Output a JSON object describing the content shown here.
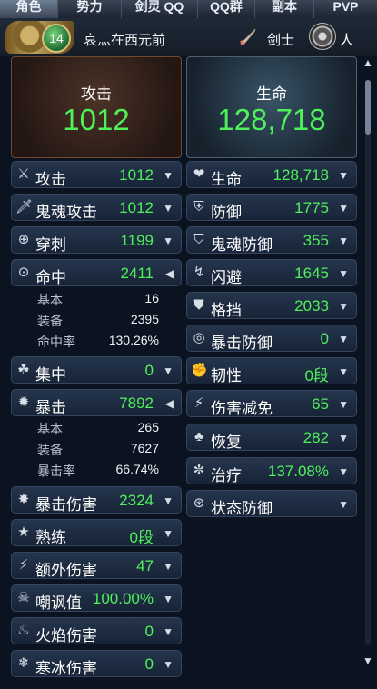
{
  "tabs": [
    "角色",
    "势力",
    "剑灵 QQ",
    "QQ群",
    "副本",
    "PVP"
  ],
  "header": {
    "level": "14",
    "player_name": "哀灬在西元前",
    "class_label": "剑士",
    "race_label": "人"
  },
  "attack_panel": {
    "title": "攻击",
    "value": "1012"
  },
  "hp_panel": {
    "title": "生命",
    "value": "128,718"
  },
  "left_rows": [
    {
      "icon": "sword-icon",
      "label": "攻击",
      "value": "1012"
    },
    {
      "icon": "soul-sword-icon",
      "label": "鬼魂攻击",
      "value": "1012"
    },
    {
      "icon": "pierce-icon",
      "label": "穿刺",
      "value": "1199"
    },
    {
      "icon": "target-icon",
      "label": "命中",
      "value": "2411"
    },
    {
      "icon": "focus-icon",
      "label": "集中",
      "value": "0"
    },
    {
      "icon": "crit-icon",
      "label": "暴击",
      "value": "7892"
    },
    {
      "icon": "crit-damage-icon",
      "label": "暴击伤害",
      "value": "2324"
    },
    {
      "icon": "mastery-icon",
      "label": "熟练",
      "value": "0段"
    },
    {
      "icon": "extra-damage-icon",
      "label": "额外伤害",
      "value": "47"
    },
    {
      "icon": "skull-icon",
      "label": "嘲讽值",
      "value": "100.00%"
    },
    {
      "icon": "fire-icon",
      "label": "火焰伤害",
      "value": "0"
    },
    {
      "icon": "frost-icon",
      "label": "寒冰伤害",
      "value": "0"
    }
  ],
  "hit_details": [
    {
      "label": "基本",
      "value": "16"
    },
    {
      "label": "装备",
      "value": "2395"
    },
    {
      "label": "命中率",
      "value": "130.26%"
    }
  ],
  "crit_details": [
    {
      "label": "基本",
      "value": "265"
    },
    {
      "label": "装备",
      "value": "7627"
    },
    {
      "label": "暴击率",
      "value": "66.74%"
    }
  ],
  "right_rows": [
    {
      "icon": "heart-icon",
      "label": "生命",
      "value": "128,718"
    },
    {
      "icon": "shield-icon",
      "label": "防御",
      "value": "1775"
    },
    {
      "icon": "soul-shield-icon",
      "label": "鬼魂防御",
      "value": "355"
    },
    {
      "icon": "evade-icon",
      "label": "闪避",
      "value": "1645"
    },
    {
      "icon": "block-icon",
      "label": "格挡",
      "value": "2033"
    },
    {
      "icon": "crit-defense-icon",
      "label": "暴击防御",
      "value": "0"
    },
    {
      "icon": "tenacity-icon",
      "label": "韧性",
      "value": "0段"
    },
    {
      "icon": "damage-reduction-icon",
      "label": "伤害减免",
      "value": "65"
    },
    {
      "icon": "recovery-icon",
      "label": "恢复",
      "value": "282"
    },
    {
      "icon": "healing-icon",
      "label": "治疗",
      "value": "137.08%"
    },
    {
      "icon": "status-defense-icon",
      "label": "状态防御",
      "value": ""
    }
  ]
}
